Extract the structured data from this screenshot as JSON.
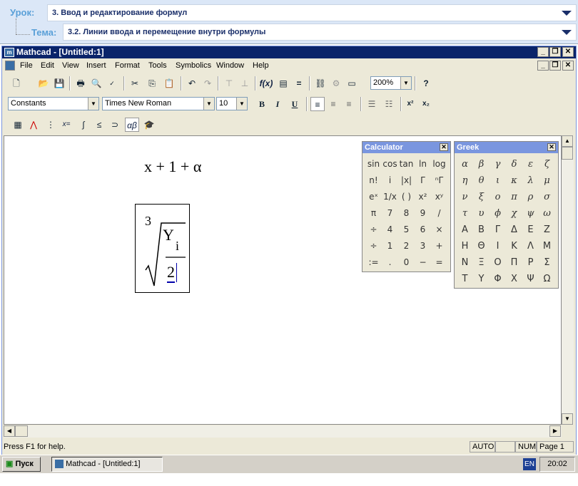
{
  "lesson": {
    "urok_label": "Урок:",
    "urok_value": "3. Ввод и редактирование формул",
    "tema_label": "Тема:",
    "tema_value": "3.2. Линии ввода и перемещение внутри формулы"
  },
  "window": {
    "title": "Mathcad - [Untitled:1]",
    "buttons": [
      "_",
      "❐",
      "✕"
    ]
  },
  "menu": [
    "File",
    "Edit",
    "View",
    "Insert",
    "Format",
    "Tools",
    "Symbolics",
    "Window",
    "Help"
  ],
  "toolbar": {
    "zoom": "200%"
  },
  "format_bar": {
    "style": "Constants",
    "font": "Times New Roman",
    "size": "10",
    "bold": "B",
    "italic": "I",
    "underline": "U"
  },
  "worksheet": {
    "expr1": "x + 1 + α",
    "root_index": "3",
    "numerator": "Y",
    "subscript": "i",
    "denominator": "2"
  },
  "calculator": {
    "title": "Calculator",
    "rows": [
      [
        "sin",
        "cos",
        "tan",
        "ln",
        "log"
      ],
      [
        "n!",
        "i",
        "|x|",
        "Γ",
        "ⁿΓ"
      ],
      [
        "eˣ",
        "1/x",
        "( )",
        "x²",
        "xʸ"
      ],
      [
        "π",
        "7",
        "8",
        "9",
        "/"
      ],
      [
        "÷",
        "4",
        "5",
        "6",
        "×"
      ],
      [
        "÷",
        "1",
        "2",
        "3",
        "+"
      ],
      [
        ":=",
        ".",
        "0",
        "−",
        "="
      ]
    ]
  },
  "greek": {
    "title": "Greek",
    "rows": [
      [
        "α",
        "β",
        "γ",
        "δ",
        "ε",
        "ζ"
      ],
      [
        "η",
        "θ",
        "ι",
        "κ",
        "λ",
        "μ"
      ],
      [
        "ν",
        "ξ",
        "ο",
        "π",
        "ρ",
        "σ"
      ],
      [
        "τ",
        "υ",
        "ϕ",
        "χ",
        "ψ",
        "ω"
      ],
      [
        "Α",
        "Β",
        "Γ",
        "Δ",
        "Ε",
        "Ζ"
      ],
      [
        "Η",
        "Θ",
        "Ι",
        "Κ",
        "Λ",
        "Μ"
      ],
      [
        "Ν",
        "Ξ",
        "Ο",
        "Π",
        "Ρ",
        "Σ"
      ],
      [
        "Τ",
        "Υ",
        "Φ",
        "Χ",
        "Ψ",
        "Ω"
      ]
    ]
  },
  "status": {
    "help": "Press F1 for help.",
    "mode": "AUTO",
    "num": "NUM",
    "page": "Page 1"
  },
  "taskbar": {
    "start": "Пуск",
    "task": "Mathcad - [Untitled:1]",
    "lang": "EN",
    "time": "20:02"
  }
}
